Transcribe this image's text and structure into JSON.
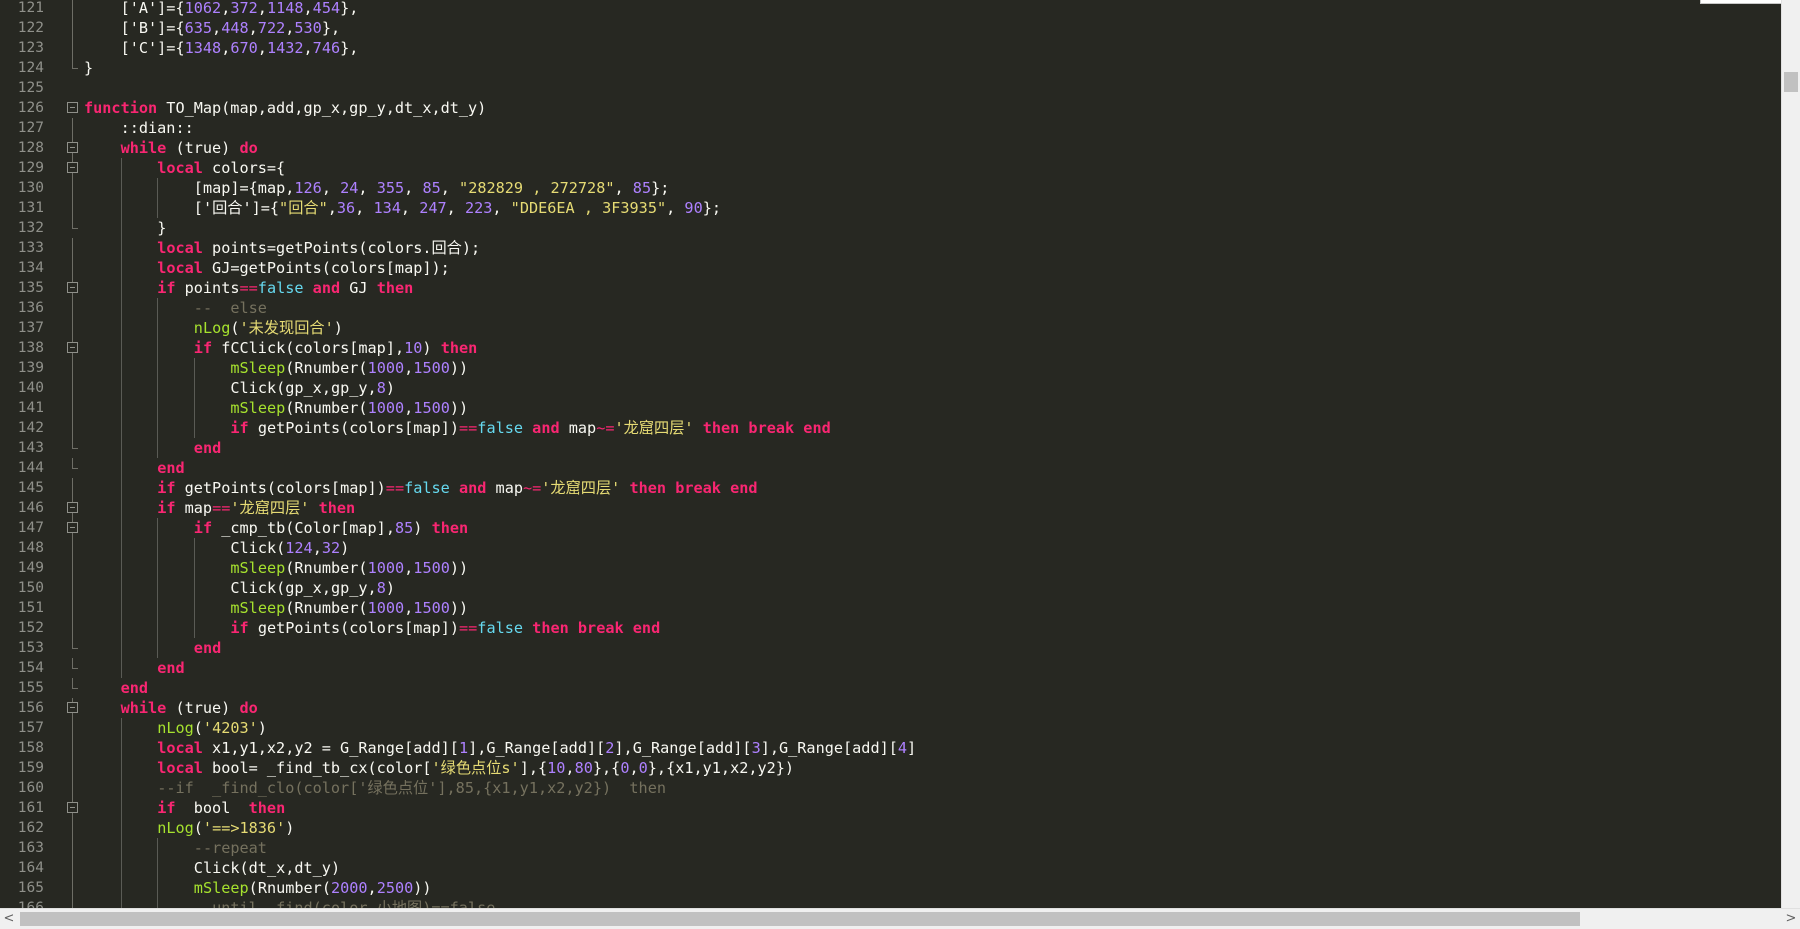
{
  "lines": [
    {
      "n": "121",
      "segs": [
        {
          "t": "['A']={",
          "c": "p"
        },
        {
          "t": "1062",
          "c": "num"
        },
        {
          "t": ",",
          "c": "p"
        },
        {
          "t": "372",
          "c": "num"
        },
        {
          "t": ",",
          "c": "p"
        },
        {
          "t": "1148",
          "c": "num"
        },
        {
          "t": ",",
          "c": "p"
        },
        {
          "t": "454",
          "c": "num"
        },
        {
          "t": "},",
          "c": "p"
        }
      ]
    },
    {
      "n": "122",
      "segs": [
        {
          "t": "['B']={",
          "c": "p"
        },
        {
          "t": "635",
          "c": "num"
        },
        {
          "t": ",",
          "c": "p"
        },
        {
          "t": "448",
          "c": "num"
        },
        {
          "t": ",",
          "c": "p"
        },
        {
          "t": "722",
          "c": "num"
        },
        {
          "t": ",",
          "c": "p"
        },
        {
          "t": "530",
          "c": "num"
        },
        {
          "t": "},",
          "c": "p"
        }
      ]
    },
    {
      "n": "123",
      "segs": [
        {
          "t": "['C']={",
          "c": "p"
        },
        {
          "t": "1348",
          "c": "num"
        },
        {
          "t": ",",
          "c": "p"
        },
        {
          "t": "670",
          "c": "num"
        },
        {
          "t": ",",
          "c": "p"
        },
        {
          "t": "1432",
          "c": "num"
        },
        {
          "t": ",",
          "c": "p"
        },
        {
          "t": "746",
          "c": "num"
        },
        {
          "t": "},",
          "c": "p"
        }
      ]
    },
    {
      "n": "124",
      "segs": [
        {
          "t": "}",
          "c": "p"
        }
      ]
    },
    {
      "n": "125",
      "segs": []
    },
    {
      "n": "126",
      "segs": [
        {
          "t": "function",
          "c": "kw"
        },
        {
          "t": " TO_Map(map,add,gp_x,gp_y,dt_x,dt_y)",
          "c": "p"
        }
      ]
    },
    {
      "n": "127",
      "segs": [
        {
          "t": "::dian::",
          "c": "p"
        }
      ]
    },
    {
      "n": "128",
      "segs": [
        {
          "t": "while",
          "c": "kw"
        },
        {
          "t": " (true) ",
          "c": "p"
        },
        {
          "t": "do",
          "c": "kw"
        }
      ]
    },
    {
      "n": "129",
      "segs": [
        {
          "t": "local",
          "c": "kw"
        },
        {
          "t": " colors={",
          "c": "p"
        }
      ]
    },
    {
      "n": "130",
      "segs": [
        {
          "t": "[map]={map,",
          "c": "p"
        },
        {
          "t": "126",
          "c": "num"
        },
        {
          "t": ", ",
          "c": "p"
        },
        {
          "t": "24",
          "c": "num"
        },
        {
          "t": ", ",
          "c": "p"
        },
        {
          "t": "355",
          "c": "num"
        },
        {
          "t": ", ",
          "c": "p"
        },
        {
          "t": "85",
          "c": "num"
        },
        {
          "t": ", ",
          "c": "p"
        },
        {
          "t": "\"282829 , 272728\"",
          "c": "str"
        },
        {
          "t": ", ",
          "c": "p"
        },
        {
          "t": "85",
          "c": "num"
        },
        {
          "t": "};",
          "c": "p"
        }
      ]
    },
    {
      "n": "131",
      "segs": [
        {
          "t": "['回合']={",
          "c": "p"
        },
        {
          "t": "\"回合\"",
          "c": "str"
        },
        {
          "t": ",",
          "c": "p"
        },
        {
          "t": "36",
          "c": "num"
        },
        {
          "t": ", ",
          "c": "p"
        },
        {
          "t": "134",
          "c": "num"
        },
        {
          "t": ", ",
          "c": "p"
        },
        {
          "t": "247",
          "c": "num"
        },
        {
          "t": ", ",
          "c": "p"
        },
        {
          "t": "223",
          "c": "num"
        },
        {
          "t": ", ",
          "c": "p"
        },
        {
          "t": "\"DDE6EA , 3F3935\"",
          "c": "str"
        },
        {
          "t": ", ",
          "c": "p"
        },
        {
          "t": "90",
          "c": "num"
        },
        {
          "t": "};",
          "c": "p"
        }
      ]
    },
    {
      "n": "132",
      "segs": [
        {
          "t": "}",
          "c": "p"
        }
      ]
    },
    {
      "n": "133",
      "segs": [
        {
          "t": "local",
          "c": "kw"
        },
        {
          "t": " points=getPoints(colors.回合);",
          "c": "p"
        }
      ]
    },
    {
      "n": "134",
      "segs": [
        {
          "t": "local",
          "c": "kw"
        },
        {
          "t": " GJ=getPoints(colors[map]);",
          "c": "p"
        }
      ]
    },
    {
      "n": "135",
      "segs": [
        {
          "t": "if",
          "c": "kw"
        },
        {
          "t": " points",
          "c": "p"
        },
        {
          "t": "==",
          "c": "op"
        },
        {
          "t": "false",
          "c": "bool"
        },
        {
          "t": " ",
          "c": "p"
        },
        {
          "t": "and",
          "c": "kw"
        },
        {
          "t": " GJ ",
          "c": "p"
        },
        {
          "t": "then",
          "c": "kw"
        }
      ]
    },
    {
      "n": "136",
      "segs": [
        {
          "t": "--  else",
          "c": "cmt"
        }
      ]
    },
    {
      "n": "137",
      "segs": [
        {
          "t": "nLog",
          "c": "fn"
        },
        {
          "t": "(",
          "c": "p"
        },
        {
          "t": "'未发现回合'",
          "c": "str"
        },
        {
          "t": ")",
          "c": "p"
        }
      ]
    },
    {
      "n": "138",
      "segs": [
        {
          "t": "if",
          "c": "kw"
        },
        {
          "t": " fCClick(colors[map],",
          "c": "p"
        },
        {
          "t": "10",
          "c": "num"
        },
        {
          "t": ") ",
          "c": "p"
        },
        {
          "t": "then",
          "c": "kw"
        }
      ]
    },
    {
      "n": "139",
      "segs": [
        {
          "t": "mSleep",
          "c": "fn"
        },
        {
          "t": "(Rnumber(",
          "c": "p"
        },
        {
          "t": "1000",
          "c": "num"
        },
        {
          "t": ",",
          "c": "p"
        },
        {
          "t": "1500",
          "c": "num"
        },
        {
          "t": "))",
          "c": "p"
        }
      ]
    },
    {
      "n": "140",
      "segs": [
        {
          "t": "Click(gp_x,gp_y,",
          "c": "p"
        },
        {
          "t": "8",
          "c": "num"
        },
        {
          "t": ")",
          "c": "p"
        }
      ]
    },
    {
      "n": "141",
      "segs": [
        {
          "t": "mSleep",
          "c": "fn"
        },
        {
          "t": "(Rnumber(",
          "c": "p"
        },
        {
          "t": "1000",
          "c": "num"
        },
        {
          "t": ",",
          "c": "p"
        },
        {
          "t": "1500",
          "c": "num"
        },
        {
          "t": "))",
          "c": "p"
        }
      ]
    },
    {
      "n": "142",
      "segs": [
        {
          "t": "if",
          "c": "kw"
        },
        {
          "t": " getPoints(colors[map])",
          "c": "p"
        },
        {
          "t": "==",
          "c": "op"
        },
        {
          "t": "false",
          "c": "bool"
        },
        {
          "t": " ",
          "c": "p"
        },
        {
          "t": "and",
          "c": "kw"
        },
        {
          "t": " map",
          "c": "p"
        },
        {
          "t": "~=",
          "c": "op"
        },
        {
          "t": "'龙窟四层'",
          "c": "str"
        },
        {
          "t": " ",
          "c": "p"
        },
        {
          "t": "then",
          "c": "kw"
        },
        {
          "t": " ",
          "c": "p"
        },
        {
          "t": "break",
          "c": "kw"
        },
        {
          "t": " ",
          "c": "p"
        },
        {
          "t": "end",
          "c": "kw"
        }
      ]
    },
    {
      "n": "143",
      "segs": [
        {
          "t": "end",
          "c": "kw"
        }
      ]
    },
    {
      "n": "144",
      "segs": [
        {
          "t": "end",
          "c": "kw"
        }
      ]
    },
    {
      "n": "145",
      "segs": [
        {
          "t": "if",
          "c": "kw"
        },
        {
          "t": " getPoints(colors[map])",
          "c": "p"
        },
        {
          "t": "==",
          "c": "op"
        },
        {
          "t": "false",
          "c": "bool"
        },
        {
          "t": " ",
          "c": "p"
        },
        {
          "t": "and",
          "c": "kw"
        },
        {
          "t": " map",
          "c": "p"
        },
        {
          "t": "~=",
          "c": "op"
        },
        {
          "t": "'龙窟四层'",
          "c": "str"
        },
        {
          "t": " ",
          "c": "p"
        },
        {
          "t": "then",
          "c": "kw"
        },
        {
          "t": " ",
          "c": "p"
        },
        {
          "t": "break",
          "c": "kw"
        },
        {
          "t": " ",
          "c": "p"
        },
        {
          "t": "end",
          "c": "kw"
        }
      ]
    },
    {
      "n": "146",
      "segs": [
        {
          "t": "if",
          "c": "kw"
        },
        {
          "t": " map",
          "c": "p"
        },
        {
          "t": "==",
          "c": "op"
        },
        {
          "t": "'龙窟四层'",
          "c": "str"
        },
        {
          "t": " ",
          "c": "p"
        },
        {
          "t": "then",
          "c": "kw"
        }
      ]
    },
    {
      "n": "147",
      "segs": [
        {
          "t": "if",
          "c": "kw"
        },
        {
          "t": " _cmp_tb(Color[map],",
          "c": "p"
        },
        {
          "t": "85",
          "c": "num"
        },
        {
          "t": ") ",
          "c": "p"
        },
        {
          "t": "then",
          "c": "kw"
        }
      ]
    },
    {
      "n": "148",
      "segs": [
        {
          "t": "Click(",
          "c": "p"
        },
        {
          "t": "124",
          "c": "num"
        },
        {
          "t": ",",
          "c": "p"
        },
        {
          "t": "32",
          "c": "num"
        },
        {
          "t": ")",
          "c": "p"
        }
      ]
    },
    {
      "n": "149",
      "segs": [
        {
          "t": "mSleep",
          "c": "fn"
        },
        {
          "t": "(Rnumber(",
          "c": "p"
        },
        {
          "t": "1000",
          "c": "num"
        },
        {
          "t": ",",
          "c": "p"
        },
        {
          "t": "1500",
          "c": "num"
        },
        {
          "t": "))",
          "c": "p"
        }
      ]
    },
    {
      "n": "150",
      "segs": [
        {
          "t": "Click(gp_x,gp_y,",
          "c": "p"
        },
        {
          "t": "8",
          "c": "num"
        },
        {
          "t": ")",
          "c": "p"
        }
      ]
    },
    {
      "n": "151",
      "segs": [
        {
          "t": "mSleep",
          "c": "fn"
        },
        {
          "t": "(Rnumber(",
          "c": "p"
        },
        {
          "t": "1000",
          "c": "num"
        },
        {
          "t": ",",
          "c": "p"
        },
        {
          "t": "1500",
          "c": "num"
        },
        {
          "t": "))",
          "c": "p"
        }
      ]
    },
    {
      "n": "152",
      "segs": [
        {
          "t": "if",
          "c": "kw"
        },
        {
          "t": " getPoints(colors[map])",
          "c": "p"
        },
        {
          "t": "==",
          "c": "op"
        },
        {
          "t": "false",
          "c": "bool"
        },
        {
          "t": " ",
          "c": "p"
        },
        {
          "t": "then",
          "c": "kw"
        },
        {
          "t": " ",
          "c": "p"
        },
        {
          "t": "break",
          "c": "kw"
        },
        {
          "t": " ",
          "c": "p"
        },
        {
          "t": "end",
          "c": "kw"
        }
      ]
    },
    {
      "n": "153",
      "segs": [
        {
          "t": "end",
          "c": "kw"
        }
      ]
    },
    {
      "n": "154",
      "segs": [
        {
          "t": "end",
          "c": "kw"
        }
      ]
    },
    {
      "n": "155",
      "segs": [
        {
          "t": "end",
          "c": "kw"
        }
      ]
    },
    {
      "n": "156",
      "segs": [
        {
          "t": "while",
          "c": "kw"
        },
        {
          "t": " (true) ",
          "c": "p"
        },
        {
          "t": "do",
          "c": "kw"
        }
      ]
    },
    {
      "n": "157",
      "segs": [
        {
          "t": "nLog",
          "c": "fn"
        },
        {
          "t": "(",
          "c": "p"
        },
        {
          "t": "'4203'",
          "c": "str"
        },
        {
          "t": ")",
          "c": "p"
        }
      ]
    },
    {
      "n": "158",
      "segs": [
        {
          "t": "local",
          "c": "kw"
        },
        {
          "t": " x1,y1,x2,y2 = G_Range[add][",
          "c": "p"
        },
        {
          "t": "1",
          "c": "num"
        },
        {
          "t": "],G_Range[add][",
          "c": "p"
        },
        {
          "t": "2",
          "c": "num"
        },
        {
          "t": "],G_Range[add][",
          "c": "p"
        },
        {
          "t": "3",
          "c": "num"
        },
        {
          "t": "],G_Range[add][",
          "c": "p"
        },
        {
          "t": "4",
          "c": "num"
        },
        {
          "t": "]",
          "c": "p"
        }
      ]
    },
    {
      "n": "159",
      "segs": [
        {
          "t": "local",
          "c": "kw"
        },
        {
          "t": " bool= _find_tb_cx(color[",
          "c": "p"
        },
        {
          "t": "'绿色点位s'",
          "c": "str"
        },
        {
          "t": "],{",
          "c": "p"
        },
        {
          "t": "10",
          "c": "num"
        },
        {
          "t": ",",
          "c": "p"
        },
        {
          "t": "80",
          "c": "num"
        },
        {
          "t": "},{",
          "c": "p"
        },
        {
          "t": "0",
          "c": "num"
        },
        {
          "t": ",",
          "c": "p"
        },
        {
          "t": "0",
          "c": "num"
        },
        {
          "t": "},{x1,y1,x2,y2})",
          "c": "p"
        }
      ]
    },
    {
      "n": "160",
      "segs": [
        {
          "t": "--if  _find_clo(color['绿色点位'],85,{x1,y1,x2,y2})  then",
          "c": "cmt"
        }
      ]
    },
    {
      "n": "161",
      "segs": [
        {
          "t": "if",
          "c": "kw"
        },
        {
          "t": "  bool  ",
          "c": "p"
        },
        {
          "t": "then",
          "c": "kw"
        }
      ]
    },
    {
      "n": "162",
      "segs": [
        {
          "t": "nLog",
          "c": "fn"
        },
        {
          "t": "(",
          "c": "p"
        },
        {
          "t": "'==>1836'",
          "c": "str"
        },
        {
          "t": ")",
          "c": "p"
        }
      ]
    },
    {
      "n": "163",
      "segs": [
        {
          "t": "--repeat",
          "c": "cmt"
        }
      ]
    },
    {
      "n": "164",
      "segs": [
        {
          "t": "Click(dt_x,dt_y)",
          "c": "p"
        }
      ]
    },
    {
      "n": "165",
      "segs": [
        {
          "t": "mSleep",
          "c": "fn"
        },
        {
          "t": "(Rnumber(",
          "c": "p"
        },
        {
          "t": "2000",
          "c": "num"
        },
        {
          "t": ",",
          "c": "p"
        },
        {
          "t": "2500",
          "c": "num"
        },
        {
          "t": "))",
          "c": "p"
        }
      ]
    },
    {
      "n": "166",
      "segs": [
        {
          "t": "--until _find(color.小地图)==false",
          "c": "cmt"
        }
      ]
    }
  ],
  "scrollbar": {
    "left_arrow": "<",
    "right_arrow": ">",
    "up_arrow": "▲"
  }
}
